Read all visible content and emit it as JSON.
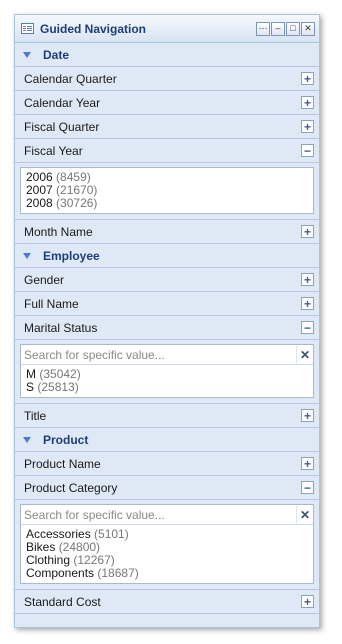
{
  "window": {
    "title": "Guided Navigation"
  },
  "window_buttons": {
    "options": "⋯",
    "minimize": "–",
    "maximize": "□",
    "close": "✕"
  },
  "date": {
    "label": "Date",
    "calendar_quarter": "Calendar Quarter",
    "calendar_year": "Calendar Year",
    "fiscal_quarter": "Fiscal Quarter",
    "fiscal_year": "Fiscal Year",
    "fiscal_year_values": [
      {
        "value": "2006",
        "count": "(8459)"
      },
      {
        "value": "2007",
        "count": "(21670)"
      },
      {
        "value": "2008",
        "count": "(30726)"
      }
    ],
    "month_name": "Month Name"
  },
  "employee": {
    "label": "Employee",
    "gender": "Gender",
    "full_name": "Full Name",
    "marital_status": "Marital Status",
    "search_placeholder": "Search for specific value...",
    "marital_values": [
      {
        "value": "M",
        "count": "(35042)"
      },
      {
        "value": "S",
        "count": "(25813)"
      }
    ],
    "title_label": "Title"
  },
  "product": {
    "label": "Product",
    "product_name": "Product Name",
    "product_category": "Product Category",
    "search_placeholder": "Search for specific value...",
    "category_values": [
      {
        "value": "Accessories",
        "count": "(5101)"
      },
      {
        "value": "Bikes",
        "count": "(24800)"
      },
      {
        "value": "Clothing",
        "count": "(12267)"
      },
      {
        "value": "Components",
        "count": "(18687)"
      }
    ],
    "standard_cost": "Standard Cost"
  },
  "glyphs": {
    "expand": "+",
    "collapse": "−",
    "clear": "✕"
  }
}
